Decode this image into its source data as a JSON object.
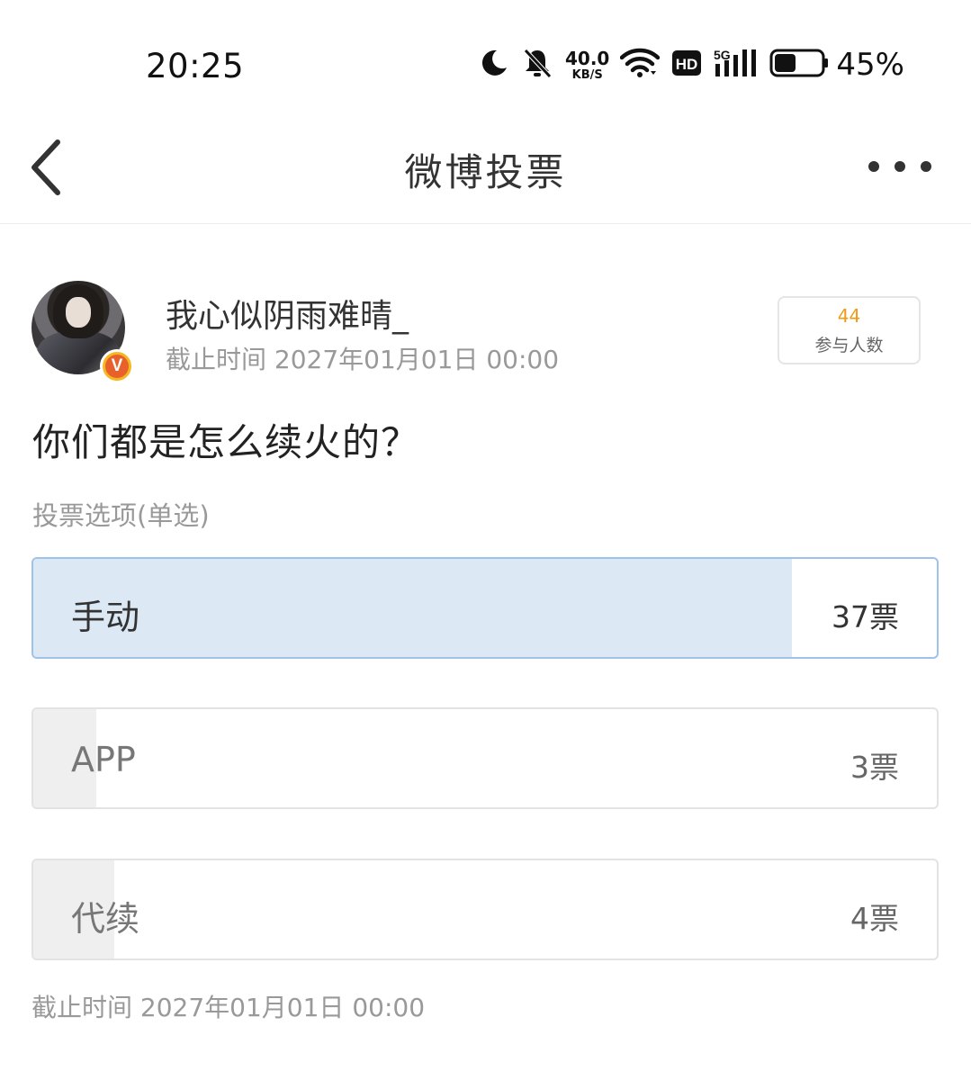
{
  "status_bar": {
    "time": "20:25",
    "net_speed_value": "40.0",
    "net_speed_unit": "KB/S",
    "hd_label": "HD",
    "network_label": "5G",
    "battery_percent": "45%",
    "battery_level": 0.45,
    "icons": [
      "moon-icon",
      "bell-muted-icon",
      "wifi-icon",
      "hd-icon",
      "signal-5g-icon",
      "battery-icon"
    ]
  },
  "nav": {
    "title": "微博投票",
    "icons": [
      "back-arrow-icon",
      "more-icon"
    ]
  },
  "author": {
    "username": "我心似阴雨难晴_",
    "deadline": "截止时间 2027年01月01日 00:00",
    "verified_badge": "V"
  },
  "participants": {
    "count": "44",
    "label": "参与人数"
  },
  "poll": {
    "question": "你们都是怎么续火的？",
    "options_label": "投票选项(单选)",
    "options": [
      {
        "label": "手动",
        "votes": "37票",
        "vote_count": 37,
        "fraction": 0.84,
        "selected": true
      },
      {
        "label": "APP",
        "votes": "3票",
        "vote_count": 3,
        "fraction": 0.07,
        "selected": false
      },
      {
        "label": "代续",
        "votes": "4票",
        "vote_count": 4,
        "fraction": 0.09,
        "selected": false
      }
    ],
    "deadline": "截止时间 2027年01月01日 00:00"
  },
  "colors": {
    "selected_fill": "#dce8f4",
    "selected_border": "#9ec3ea",
    "unselected_fill": "#efefef",
    "participant_count": "#f09a1a",
    "badge_outer": "#f5b822",
    "badge_inner": "#e8602a"
  }
}
